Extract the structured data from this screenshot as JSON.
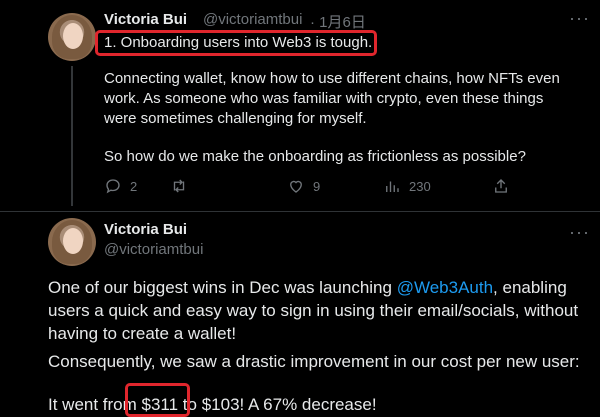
{
  "tweet1": {
    "name": "Victoria Bui",
    "handle": "@victoriamtbui",
    "date": "· 1月6日",
    "headline": "1. Onboarding users into Web3 is tough.",
    "para1": "Connecting wallet, know how to use different chains, how NFTs even work. As someone who was familiar with crypto, even these things were sometimes challenging for myself.",
    "para2": "So how do we make the onboarding as frictionless as possible?",
    "actions": {
      "replies": "2",
      "retweets": "",
      "likes": "9",
      "views": "230"
    }
  },
  "tweet2": {
    "name": "Victoria Bui",
    "handle": "@victoriamtbui",
    "para1_before": "One of our biggest wins in Dec was launching ",
    "para1_mention": "@Web3Auth",
    "para1_after": ", enabling users a quick and easy way to sign in using their email/socials, without having to create a wallet!",
    "para2": "Consequently, we saw a drastic improvement in our cost per new user:",
    "para3_a": "It went fro",
    "para3_b": "m $311 t",
    "para3_c": "o $103! A 67% decrease!"
  },
  "colors": {
    "background": "#000000",
    "text": "#e7e9ea",
    "muted": "#71767b",
    "link": "#1d9bf0",
    "highlight": "#e0262d"
  },
  "icons": [
    "reply-icon",
    "retweet-icon",
    "like-icon",
    "views-icon",
    "share-icon",
    "more-icon"
  ]
}
